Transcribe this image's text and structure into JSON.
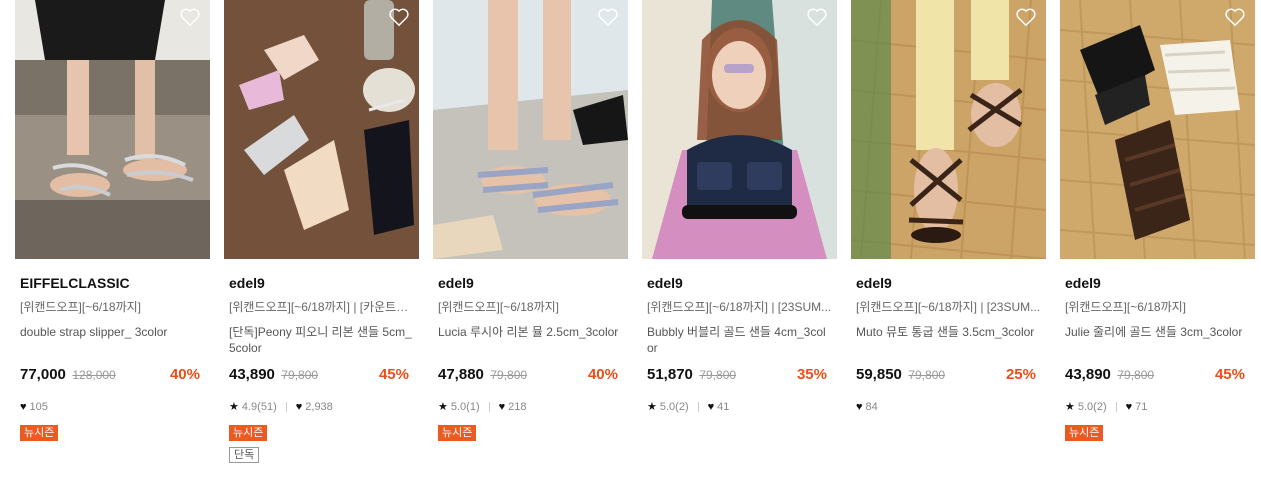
{
  "products": [
    {
      "brand": "EIFFELCLASSIC",
      "promo": "[위캔드오프][~6/18까지]",
      "name": "double strap slipper_ 3color",
      "price": "77,000",
      "original_price": "128,000",
      "discount": "40%",
      "rating": "",
      "likes": "105",
      "badges": [
        "뉴시즌"
      ]
    },
    {
      "brand": "edel9",
      "promo": "[위캔드오프][~6/18까지] | [카운트다...",
      "name": "[단독]Peony 피오니 리본 샌들 5cm_5color",
      "price": "43,890",
      "original_price": "79,800",
      "discount": "45%",
      "rating": "4.9(51)",
      "likes": "2,938",
      "badges": [
        "뉴시즌",
        "단독"
      ]
    },
    {
      "brand": "edel9",
      "promo": "[위캔드오프][~6/18까지]",
      "name": "Lucia 루시아 리본 뮬 2.5cm_3color",
      "price": "47,880",
      "original_price": "79,800",
      "discount": "40%",
      "rating": "5.0(1)",
      "likes": "218",
      "badges": [
        "뉴시즌"
      ]
    },
    {
      "brand": "edel9",
      "promo": "[위캔드오프][~6/18까지] | [23SUM...",
      "name": "Bubbly 버블리 골드 샌들 4cm_3color",
      "price": "51,870",
      "original_price": "79,800",
      "discount": "35%",
      "rating": "5.0(2)",
      "likes": "41",
      "badges": []
    },
    {
      "brand": "edel9",
      "promo": "[위캔드오프][~6/18까지] | [23SUM...",
      "name": "Muto 뮤토 통굽 샌들 3.5cm_3color",
      "price": "59,850",
      "original_price": "79,800",
      "discount": "25%",
      "rating": "",
      "likes": "84",
      "badges": []
    },
    {
      "brand": "edel9",
      "promo": "[위캔드오프][~6/18까지]",
      "name": "Julie 줄리에 골드 샌들 3cm_3color",
      "price": "43,890",
      "original_price": "79,800",
      "discount": "45%",
      "rating": "5.0(2)",
      "likes": "71",
      "badges": [
        "뉴시즌"
      ]
    }
  ],
  "colors": {
    "discount": "#f04c18",
    "new_badge": "#ec5a1f"
  },
  "icons": {
    "wishlist": "heart-outline-icon",
    "rating": "star-icon",
    "likes": "heart-icon"
  }
}
